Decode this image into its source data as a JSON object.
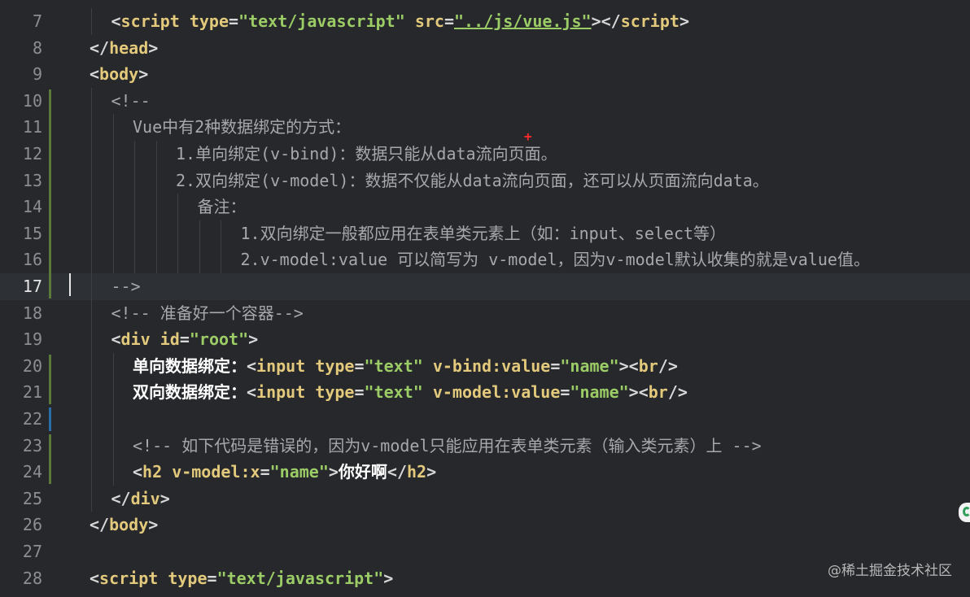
{
  "editor": {
    "lines": [
      {
        "n": "7",
        "tokens": [
          {
            "t": "<",
            "c": "punct"
          },
          {
            "t": "script",
            "c": "tag"
          },
          {
            "t": " ",
            "c": "txt"
          },
          {
            "t": "type",
            "c": "attr"
          },
          {
            "t": "=",
            "c": "punct"
          },
          {
            "t": "\"text/javascript\"",
            "c": "str"
          },
          {
            "t": " ",
            "c": "txt"
          },
          {
            "t": "src",
            "c": "attr"
          },
          {
            "t": "=",
            "c": "punct"
          },
          {
            "t": "\"../js/vue.js\"",
            "c": "str"
          },
          {
            "t": "></",
            "c": "punct"
          },
          {
            "t": "script",
            "c": "tag"
          },
          {
            "t": ">",
            "c": "punct"
          }
        ],
        "indent": 1
      },
      {
        "n": "8",
        "tokens": [
          {
            "t": "</",
            "c": "punct"
          },
          {
            "t": "head",
            "c": "tag"
          },
          {
            "t": ">",
            "c": "punct"
          }
        ],
        "indent": 0
      },
      {
        "n": "9",
        "tokens": [
          {
            "t": "<",
            "c": "punct"
          },
          {
            "t": "body",
            "c": "tag"
          },
          {
            "t": ">",
            "c": "punct"
          }
        ],
        "indent": 0
      },
      {
        "n": "10",
        "tokens": [
          {
            "t": "<!--",
            "c": "cm"
          }
        ],
        "indent": 1
      },
      {
        "n": "11",
        "tokens": [
          {
            "t": "Vue中有2种数据绑定的方式：",
            "c": "cm"
          }
        ],
        "indent": 2
      },
      {
        "n": "12",
        "tokens": [
          {
            "t": "1.单向绑定(v-bind)：数据只能从data流向页面。",
            "c": "cm"
          }
        ],
        "indent": 4
      },
      {
        "n": "13",
        "tokens": [
          {
            "t": "2.双向绑定(v-model)：数据不仅能从data流向页面，还可以从页面流向data。",
            "c": "cm"
          }
        ],
        "indent": 4
      },
      {
        "n": "14",
        "tokens": [
          {
            "t": "备注：",
            "c": "cm"
          }
        ],
        "indent": 5
      },
      {
        "n": "15",
        "tokens": [
          {
            "t": "1.双向绑定一般都应用在表单类元素上（如：input、select等）",
            "c": "cm"
          }
        ],
        "indent": 7
      },
      {
        "n": "16",
        "tokens": [
          {
            "t": "2.v-model:value 可以简写为 v-model，因为v-model默认收集的就是value值。",
            "c": "cm"
          }
        ],
        "indent": 7
      },
      {
        "n": "17",
        "tokens": [
          {
            "t": "-->",
            "c": "cm"
          }
        ],
        "indent": 1,
        "current": true
      },
      {
        "n": "18",
        "tokens": [
          {
            "t": "<!-- 准备好一个容器-->",
            "c": "cm"
          }
        ],
        "indent": 1
      },
      {
        "n": "19",
        "tokens": [
          {
            "t": "<",
            "c": "punct"
          },
          {
            "t": "div",
            "c": "tag"
          },
          {
            "t": " ",
            "c": "txt"
          },
          {
            "t": "id",
            "c": "attr"
          },
          {
            "t": "=",
            "c": "punct"
          },
          {
            "t": "\"root\"",
            "c": "str"
          },
          {
            "t": ">",
            "c": "punct"
          }
        ],
        "indent": 1
      },
      {
        "n": "20",
        "tokens": [
          {
            "t": "单向数据绑定：",
            "c": "txt"
          },
          {
            "t": "<",
            "c": "punct"
          },
          {
            "t": "input",
            "c": "tag"
          },
          {
            "t": " ",
            "c": "txt"
          },
          {
            "t": "type",
            "c": "attr"
          },
          {
            "t": "=",
            "c": "punct"
          },
          {
            "t": "\"text\"",
            "c": "str"
          },
          {
            "t": " ",
            "c": "txt"
          },
          {
            "t": "v-bind:value",
            "c": "attr"
          },
          {
            "t": "=",
            "c": "punct"
          },
          {
            "t": "\"name\"",
            "c": "str"
          },
          {
            "t": "><",
            "c": "punct"
          },
          {
            "t": "br",
            "c": "tag"
          },
          {
            "t": "/>",
            "c": "punct"
          }
        ],
        "indent": 2
      },
      {
        "n": "21",
        "tokens": [
          {
            "t": "双向数据绑定：",
            "c": "txt"
          },
          {
            "t": "<",
            "c": "punct"
          },
          {
            "t": "input",
            "c": "tag"
          },
          {
            "t": " ",
            "c": "txt"
          },
          {
            "t": "type",
            "c": "attr"
          },
          {
            "t": "=",
            "c": "punct"
          },
          {
            "t": "\"text\"",
            "c": "str"
          },
          {
            "t": " ",
            "c": "txt"
          },
          {
            "t": "v-model:value",
            "c": "attr"
          },
          {
            "t": "=",
            "c": "punct"
          },
          {
            "t": "\"name\"",
            "c": "str"
          },
          {
            "t": "><",
            "c": "punct"
          },
          {
            "t": "br",
            "c": "tag"
          },
          {
            "t": "/>",
            "c": "punct"
          }
        ],
        "indent": 2
      },
      {
        "n": "22",
        "tokens": [],
        "indent": 2
      },
      {
        "n": "23",
        "tokens": [
          {
            "t": "<!-- 如下代码是错误的，因为v-model只能应用在表单类元素（输入类元素）上 -->",
            "c": "cm"
          }
        ],
        "indent": 2
      },
      {
        "n": "24",
        "tokens": [
          {
            "t": "<",
            "c": "punct"
          },
          {
            "t": "h2",
            "c": "tag"
          },
          {
            "t": " ",
            "c": "txt"
          },
          {
            "t": "v-model:x",
            "c": "attr"
          },
          {
            "t": "=",
            "c": "punct"
          },
          {
            "t": "\"name\"",
            "c": "str"
          },
          {
            "t": ">",
            "c": "punct"
          },
          {
            "t": "你好啊",
            "c": "txt"
          },
          {
            "t": "</",
            "c": "punct"
          },
          {
            "t": "h2",
            "c": "tag"
          },
          {
            "t": ">",
            "c": "punct"
          }
        ],
        "indent": 2
      },
      {
        "n": "25",
        "tokens": [
          {
            "t": "</",
            "c": "punct"
          },
          {
            "t": "div",
            "c": "tag"
          },
          {
            "t": ">",
            "c": "punct"
          }
        ],
        "indent": 1
      },
      {
        "n": "26",
        "tokens": [
          {
            "t": "</",
            "c": "punct"
          },
          {
            "t": "body",
            "c": "tag"
          },
          {
            "t": ">",
            "c": "punct"
          }
        ],
        "indent": 0
      },
      {
        "n": "27",
        "tokens": [],
        "indent": 0
      },
      {
        "n": "28",
        "tokens": [
          {
            "t": "<",
            "c": "punct"
          },
          {
            "t": "script",
            "c": "tag"
          },
          {
            "t": " ",
            "c": "txt"
          },
          {
            "t": "type",
            "c": "attr"
          },
          {
            "t": "=",
            "c": "punct"
          },
          {
            "t": "\"text/javascript\"",
            "c": "str"
          },
          {
            "t": ">",
            "c": "punct"
          }
        ],
        "indent": 0
      }
    ]
  },
  "watermark": "@稀土掘金技术社区",
  "colors": {
    "background": "#26282c",
    "tag": "#e3c97b",
    "string": "#9ccc65",
    "comment": "#a6a8ab",
    "text": "#ffffff",
    "change_bar_added": "#5b7a3a",
    "change_bar_modified": "#2a6ea8"
  }
}
